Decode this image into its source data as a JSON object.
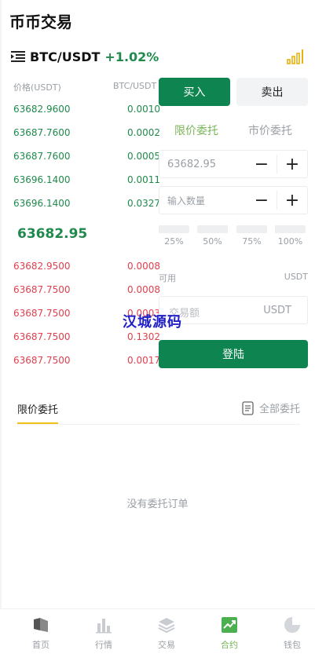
{
  "header": {
    "title": "币币交易"
  },
  "pair": {
    "name": "BTC/USDT",
    "change": "+1.02%"
  },
  "orderbook": {
    "price_header": "价格(USDT)",
    "amount_header": "BTC/USDT",
    "bids": [
      {
        "price": "63682.9600",
        "amount": "0.0010"
      },
      {
        "price": "63687.7600",
        "amount": "0.0002"
      },
      {
        "price": "63687.7600",
        "amount": "0.0005"
      },
      {
        "price": "63696.1400",
        "amount": "0.0011"
      },
      {
        "price": "63696.1400",
        "amount": "0.0327"
      }
    ],
    "last_price": "63682.95",
    "asks": [
      {
        "price": "63682.9500",
        "amount": "0.0008"
      },
      {
        "price": "63687.7500",
        "amount": "0.0008"
      },
      {
        "price": "63687.7500",
        "amount": "0.0003"
      },
      {
        "price": "63687.7500",
        "amount": "0.1302"
      },
      {
        "price": "63687.7500",
        "amount": "0.0017"
      }
    ]
  },
  "trade": {
    "buy_label": "买入",
    "sell_label": "卖出",
    "limit_label": "限价委托",
    "market_label": "市价委托",
    "price_value": "63682.95",
    "quantity_placeholder": "输入数量",
    "minus": "−",
    "plus": "+",
    "percents": [
      "25%",
      "50%",
      "75%",
      "100%"
    ],
    "available_label": "可用",
    "available_unit": "USDT",
    "amount_placeholder": "交易额",
    "amount_unit": "USDT",
    "login_label": "登陆"
  },
  "watermark": "汉城源码",
  "orders": {
    "tab_label": "限价委托",
    "all_label": "全部委托",
    "empty_text": "没有委托订单"
  },
  "nav": {
    "items": [
      {
        "label": "首页",
        "icon": "home-icon"
      },
      {
        "label": "行情",
        "icon": "market-icon"
      },
      {
        "label": "交易",
        "icon": "trade-icon"
      },
      {
        "label": "合约",
        "icon": "contract-icon"
      },
      {
        "label": "钱包",
        "icon": "wallet-icon"
      }
    ],
    "active_index": 3
  },
  "colors": {
    "green": "#1f8a4c",
    "red": "#e0404f",
    "button_green": "#0e8550",
    "accent_light_green": "#7ab45a",
    "tab_underline": "#f1c21b"
  }
}
